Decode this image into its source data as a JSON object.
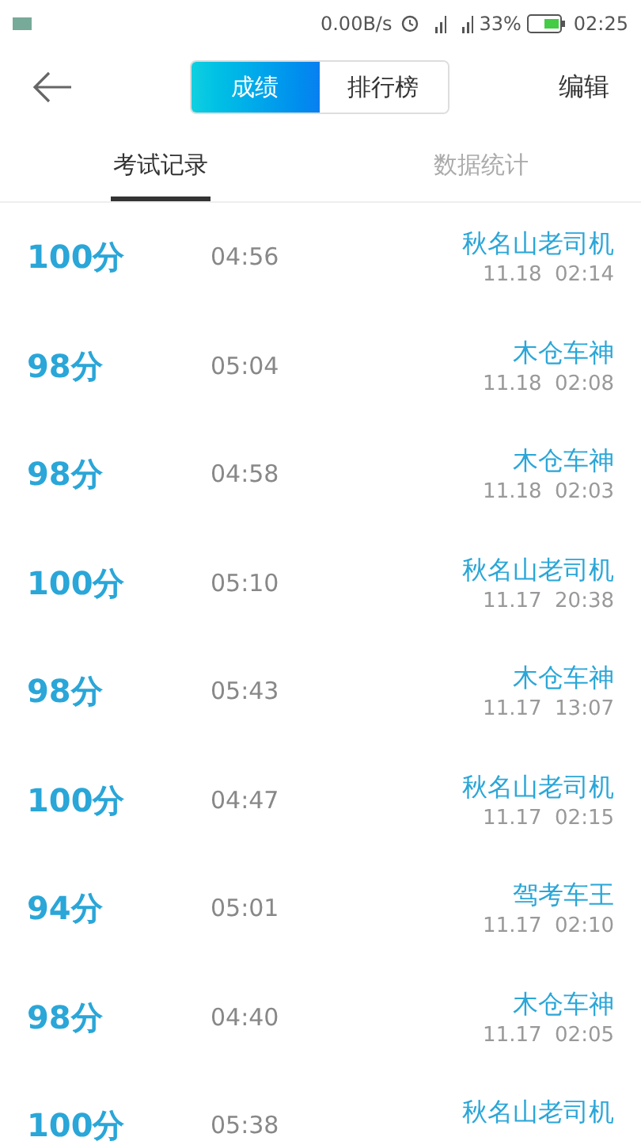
{
  "status_bar": {
    "speed": "0.00B/s",
    "battery": "33%",
    "time": "02:25"
  },
  "header": {
    "segments": [
      {
        "label": "成绩",
        "selected": true
      },
      {
        "label": "排行榜",
        "selected": false
      }
    ],
    "action": "编辑"
  },
  "tabs": [
    {
      "label": "考试记录",
      "selected": true
    },
    {
      "label": "数据统计",
      "selected": false
    }
  ],
  "records": [
    {
      "score": "100分",
      "duration": "04:56",
      "title": "秋名山老司机",
      "date": "11.18  02:14"
    },
    {
      "score": "98分",
      "duration": "05:04",
      "title": "木仓车神",
      "date": "11.18  02:08"
    },
    {
      "score": "98分",
      "duration": "04:58",
      "title": "木仓车神",
      "date": "11.18  02:03"
    },
    {
      "score": "100分",
      "duration": "05:10",
      "title": "秋名山老司机",
      "date": "11.17  20:38"
    },
    {
      "score": "98分",
      "duration": "05:43",
      "title": "木仓车神",
      "date": "11.17  13:07"
    },
    {
      "score": "100分",
      "duration": "04:47",
      "title": "秋名山老司机",
      "date": "11.17  02:15"
    },
    {
      "score": "94分",
      "duration": "05:01",
      "title": "驾考车王",
      "date": "11.17  02:10"
    },
    {
      "score": "98分",
      "duration": "04:40",
      "title": "木仓车神",
      "date": "11.17  02:05"
    },
    {
      "score": "100分",
      "duration": "05:38",
      "title": "秋名山老司机"
    }
  ]
}
